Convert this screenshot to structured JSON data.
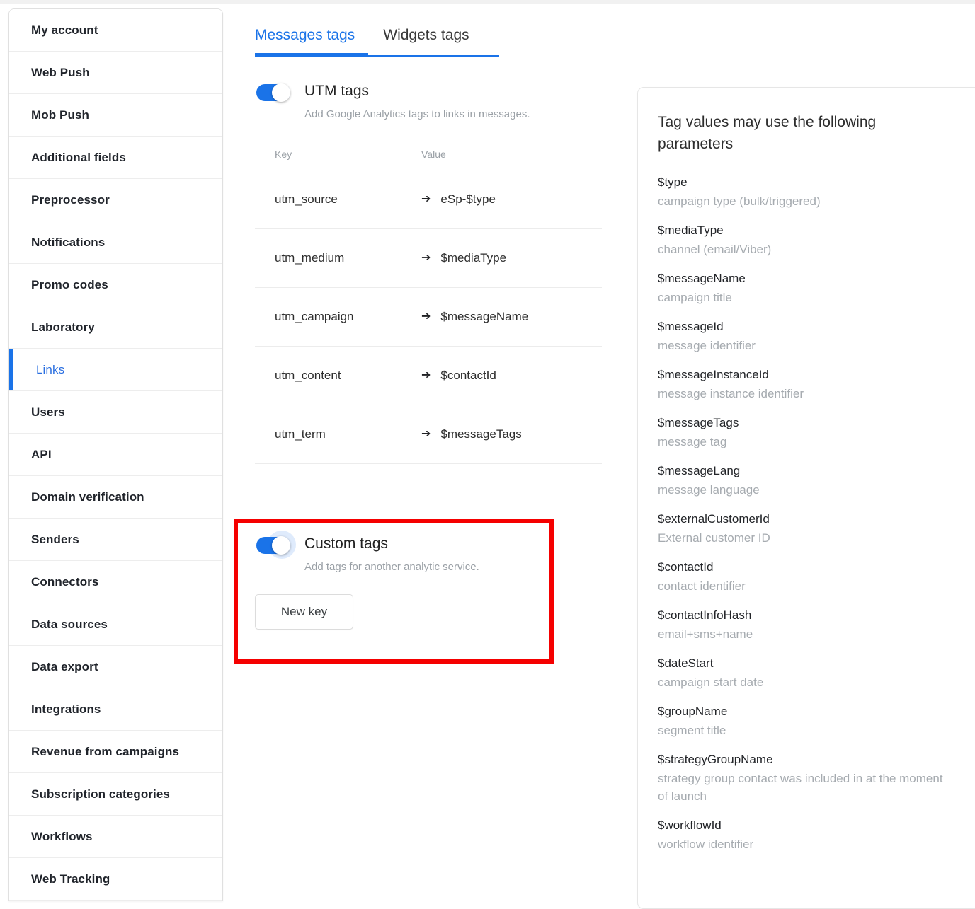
{
  "sidebar": {
    "items": [
      {
        "label": "My account",
        "active": false
      },
      {
        "label": "Web Push",
        "active": false
      },
      {
        "label": "Mob Push",
        "active": false
      },
      {
        "label": "Additional fields",
        "active": false
      },
      {
        "label": "Preprocessor",
        "active": false
      },
      {
        "label": "Notifications",
        "active": false
      },
      {
        "label": "Promo codes",
        "active": false
      },
      {
        "label": "Laboratory",
        "active": false
      },
      {
        "label": "Links",
        "active": true
      },
      {
        "label": "Users",
        "active": false
      },
      {
        "label": "API",
        "active": false
      },
      {
        "label": "Domain verification",
        "active": false
      },
      {
        "label": "Senders",
        "active": false
      },
      {
        "label": "Connectors",
        "active": false
      },
      {
        "label": "Data sources",
        "active": false
      },
      {
        "label": "Data export",
        "active": false
      },
      {
        "label": "Integrations",
        "active": false
      },
      {
        "label": "Revenue from campaigns",
        "active": false
      },
      {
        "label": "Subscription categories",
        "active": false
      },
      {
        "label": "Workflows",
        "active": false
      },
      {
        "label": "Web Tracking",
        "active": false
      }
    ]
  },
  "main": {
    "tabs": [
      {
        "label": "Messages tags",
        "active": true
      },
      {
        "label": "Widgets tags",
        "active": false
      }
    ],
    "utm_section": {
      "toggle_label": "UTM tags",
      "toggle_state": "on",
      "description": "Add Google Analytics tags to links in messages.",
      "table": {
        "headers": [
          "Key",
          "Value"
        ],
        "arrow_icon": "arrow-right-icon",
        "arrow_glyph": "➔",
        "rows": [
          {
            "key": "utm_source",
            "value": "eSp-$type"
          },
          {
            "key": "utm_medium",
            "value": "$mediaType"
          },
          {
            "key": "utm_campaign",
            "value": "$messageName"
          },
          {
            "key": "utm_content",
            "value": "$contactId"
          },
          {
            "key": "utm_term",
            "value": "$messageTags"
          }
        ]
      }
    },
    "custom_section": {
      "toggle_label": "Custom tags",
      "toggle_state": "on",
      "description": "Add tags for another analytic service.",
      "new_key_label": "New key",
      "highlight_color": "#f50000"
    }
  },
  "params_panel": {
    "title": "Tag values may use the following parameters",
    "items": [
      {
        "name": "$type",
        "desc": "campaign type (bulk/triggered)"
      },
      {
        "name": "$mediaType",
        "desc": "channel (email/Viber)"
      },
      {
        "name": "$messageName",
        "desc": "campaign title"
      },
      {
        "name": "$messageId",
        "desc": "message identifier"
      },
      {
        "name": "$messageInstanceId",
        "desc": "message instance identifier"
      },
      {
        "name": "$messageTags",
        "desc": "message tag"
      },
      {
        "name": "$messageLang",
        "desc": "message language"
      },
      {
        "name": "$externalCustomerId",
        "desc": "External customer ID"
      },
      {
        "name": "$contactId",
        "desc": "contact identifier"
      },
      {
        "name": "$contactInfoHash",
        "desc": "email+sms+name"
      },
      {
        "name": "$dateStart",
        "desc": "campaign start date"
      },
      {
        "name": "$groupName",
        "desc": "segment title"
      },
      {
        "name": "$strategyGroupName",
        "desc": "strategy group contact was included in at the moment of launch"
      },
      {
        "name": "$workflowId",
        "desc": "workflow identifier"
      }
    ]
  },
  "colors": {
    "accent": "#1a73e8",
    "highlight": "#f50000",
    "text": "#20242b",
    "muted": "#9aa0a6"
  }
}
